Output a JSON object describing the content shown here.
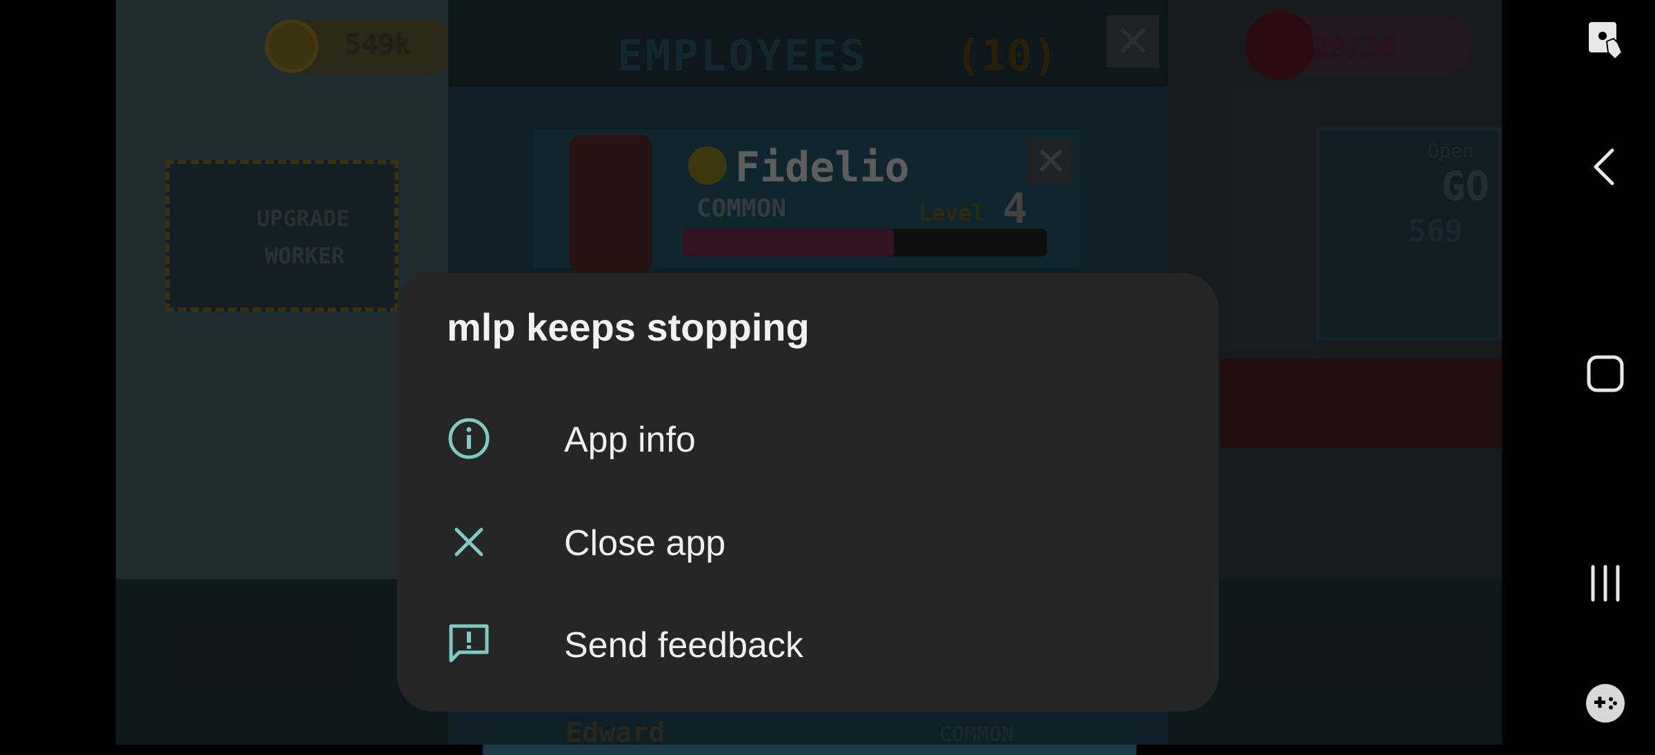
{
  "game": {
    "coins": "549k",
    "panel_title": "EMPLOYEES",
    "panel_count": "(10)",
    "card": {
      "name": "Fidelio",
      "rarity": "COMMON",
      "level_label": "Level",
      "level_value": "4",
      "progress": 0.58
    },
    "upgrade_line1": "UPGRADE",
    "upgrade_line2": "WORKER",
    "gems": "29/38",
    "side_open": "Open",
    "side_go": "GO",
    "side_num": "569",
    "bottom_employee_name": "Edward",
    "bottom_employee_rarity": "COMMON"
  },
  "dialog": {
    "title": "mlp keeps stopping",
    "options": [
      {
        "label": "App info",
        "icon": "info-icon"
      },
      {
        "label": "Close app",
        "icon": "close-icon"
      },
      {
        "label": "Send feedback",
        "icon": "feedback-icon"
      }
    ],
    "accent_color": "#7ecbc3"
  },
  "navbar": {
    "buttons": [
      "screen-touch-icon",
      "back-icon",
      "home-icon",
      "recents-icon",
      "game-tools-icon"
    ]
  }
}
